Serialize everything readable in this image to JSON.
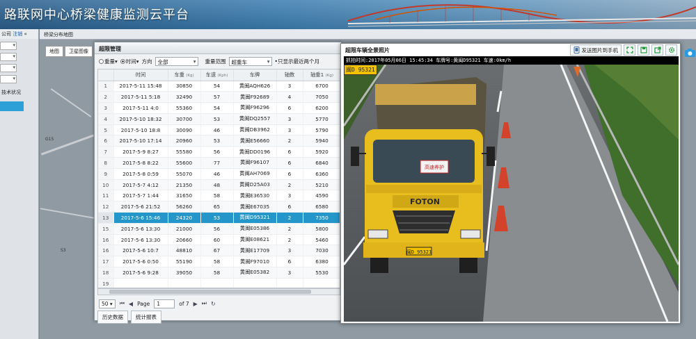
{
  "app": {
    "title": "路联网中心桥梁健康监测云平台"
  },
  "left_panel": {
    "company": "公司",
    "link": "注销",
    "collapse": "«",
    "text": "技术状况"
  },
  "map_panel": {
    "title": "桥梁分布地图",
    "tabs": [
      "地图",
      "卫星图像"
    ],
    "labels": [
      "G15",
      "S3",
      "G15"
    ]
  },
  "overweight": {
    "title": "超限管理",
    "filter": {
      "opt_weight": "重量▾",
      "opt_time": "时间▾",
      "direction_label": "方向",
      "direction_value": "全部",
      "weight_range_label": "重量范围",
      "weight_range_value": "超重车",
      "note": "•只显示最近两个月"
    },
    "columns": [
      "",
      "时间",
      "车重",
      "车速",
      "车牌",
      "轴数",
      "轴重1"
    ],
    "column_units": [
      "",
      "",
      "(Kg)",
      "(Kph)",
      "",
      "",
      "(Kg)"
    ],
    "rows": [
      [
        "1",
        "2017-5-11 15:48",
        "30850",
        "54",
        "黄闽AQH626",
        "3",
        "6700"
      ],
      [
        "2",
        "2017-5-11 5:18",
        "32490",
        "57",
        "黄闽F92689",
        "4",
        "7050"
      ],
      [
        "3",
        "2017-5-11 4:0",
        "55360",
        "54",
        "黄闽F96296",
        "6",
        "6200"
      ],
      [
        "4",
        "2017-5-10 18:32",
        "30700",
        "53",
        "黄闽DQ2557",
        "3",
        "5770"
      ],
      [
        "5",
        "2017-5-10 18:8",
        "30090",
        "46",
        "黄闽DB3962",
        "3",
        "5790"
      ],
      [
        "6",
        "2017-5-10 17:14",
        "20960",
        "53",
        "黄闽E56660",
        "2",
        "5940"
      ],
      [
        "7",
        "2017-5-9 8:27",
        "55580",
        "56",
        "黄闽DD0196",
        "6",
        "5920"
      ],
      [
        "8",
        "2017-5-8 8:22",
        "55600",
        "77",
        "黄闽F96107",
        "6",
        "6840"
      ],
      [
        "9",
        "2017-5-8 0:59",
        "55070",
        "46",
        "黄闽AH7069",
        "6",
        "6360"
      ],
      [
        "10",
        "2017-5-7 4:12",
        "21350",
        "48",
        "黄闽D25A03",
        "2",
        "5210"
      ],
      [
        "11",
        "2017-5-7 1:44",
        "31650",
        "58",
        "黄闽E36530",
        "3",
        "4590"
      ],
      [
        "12",
        "2017-5-6 21:52",
        "56260",
        "65",
        "黄闽E67035",
        "6",
        "6580"
      ],
      [
        "13",
        "2017-5-6 15:46",
        "24320",
        "53",
        "黄闽D95321",
        "2",
        "7350"
      ],
      [
        "15",
        "2017-5-6 13:30",
        "21000",
        "56",
        "黄闽E05386",
        "2",
        "5800"
      ],
      [
        "16",
        "2017-5-6 13:30",
        "20660",
        "60",
        "黄闽E08621",
        "2",
        "5460"
      ],
      [
        "16",
        "2017-5-6 10:7",
        "48810",
        "67",
        "黄闽E17709",
        "3",
        "7030"
      ],
      [
        "17",
        "2017-5-6 0:50",
        "55190",
        "58",
        "黄闽F97010",
        "6",
        "6380"
      ],
      [
        "18",
        "2017-5-6 9:28",
        "39050",
        "58",
        "黄闽E05382",
        "3",
        "5530"
      ],
      [
        "19",
        "",
        "",
        "",
        "",
        "",
        ""
      ]
    ],
    "selected_row_index": 12,
    "pager": {
      "page_size": "50",
      "page_label": "Page",
      "page_value": "1",
      "of_label": "of 7"
    },
    "tabs": [
      "历史数据",
      "统计报表"
    ]
  },
  "photo": {
    "title": "超限车辆全景照片",
    "send_label": "发送图片到手机",
    "caption": "抓拍时间:2017年05月06日 15:45:34  车牌号:黄闽D95321  车速:0km/h",
    "plate_tag": "闽D 95321",
    "truck_brand": "FOTON",
    "truck_plate": "闽D 95321",
    "windshield_sign": "高速养护"
  },
  "colors": {
    "selected_row": "#2596c9",
    "truck_yellow": "#f2c200",
    "tool_green": "#1e9a3a"
  }
}
